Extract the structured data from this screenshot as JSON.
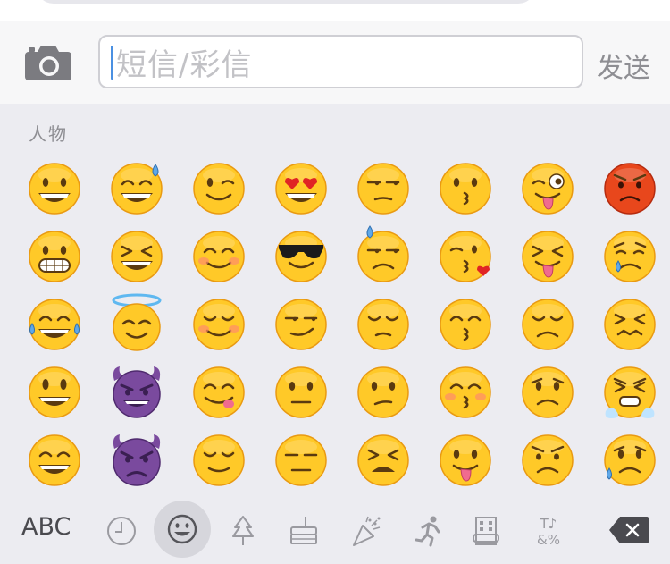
{
  "input_bar": {
    "placeholder": "短信/彩信",
    "send_label": "发送",
    "camera_icon": "camera-icon"
  },
  "keyboard": {
    "category_label": "人物",
    "emoji_rows": [
      [
        "grinning",
        "grinning-sweat",
        "winking",
        "heart-eyes",
        "unamused",
        "kissing",
        "winking-tongue",
        "angry-red"
      ],
      [
        "grimacing",
        "squinting-laugh",
        "smiling",
        "sunglasses",
        "downcast-sweat",
        "kissing-heart",
        "squinting-tongue",
        "crying"
      ],
      [
        "tears-of-joy",
        "halo",
        "relaxed",
        "smirking",
        "pensive",
        "kissing-closed-eyes",
        "disappointed",
        "confounded"
      ],
      [
        "smiley",
        "imp-smiling",
        "yum",
        "neutral",
        "confused",
        "kissing-blush",
        "worried",
        "persevering-tears"
      ],
      [
        "smile",
        "imp-angry",
        "relieved",
        "expressionless",
        "tired",
        "tongue",
        "angry",
        "sad-sweat"
      ]
    ],
    "colors": {
      "face": "#ffc928",
      "face_edge": "#e99a12",
      "purple": "#7a4a9e",
      "red_face": "#e8471c",
      "keyboard_bg": "#ececf1",
      "active_tab_bg": "#d6d6dc"
    },
    "tab_bar": {
      "abc_label": "ABC",
      "tabs": [
        "clock-icon",
        "smiley-icon",
        "tree-icon",
        "cake-icon",
        "party-popper-icon",
        "runner-icon",
        "building-icon",
        "symbols-icon"
      ],
      "symbols_text_top": "T♪",
      "symbols_text_bottom": "&%",
      "active_tab": "smiley-icon"
    }
  }
}
